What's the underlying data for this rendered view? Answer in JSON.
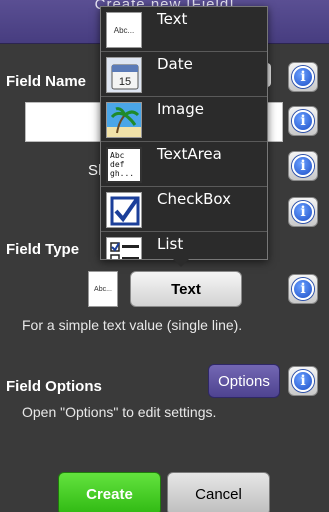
{
  "header": {
    "title": "Create new [Field]"
  },
  "field_name": {
    "label": "Field Name",
    "value": ""
  },
  "partial": {
    "text": "Sh"
  },
  "field_type": {
    "label": "Field Type",
    "selected": "Text",
    "thumb_text": "Abc...",
    "description": "For a simple text value (single line)."
  },
  "field_options": {
    "label": "Field Options",
    "button": "Options",
    "description": "Open \"Options\" to edit settings."
  },
  "footer": {
    "create": "Create",
    "cancel": "Cancel"
  },
  "info_glyph": "i",
  "dropdown": {
    "items": [
      {
        "label": "Text",
        "icon": "text-type-icon",
        "icon_text": "Abc..."
      },
      {
        "label": "Date",
        "icon": "calendar-icon",
        "icon_text": "15"
      },
      {
        "label": "Image",
        "icon": "image-icon"
      },
      {
        "label": "TextArea",
        "icon": "textarea-icon",
        "icon_text": "Abc def gh..."
      },
      {
        "label": "CheckBox",
        "icon": "checkbox-icon"
      },
      {
        "label": "List",
        "icon": "list-icon"
      }
    ]
  },
  "colors": {
    "titlebar": "#473d80",
    "background": "#3a3a3a",
    "create": "#3fcf1c",
    "options": "#5a4fa0",
    "info": "#1e4fc7"
  }
}
